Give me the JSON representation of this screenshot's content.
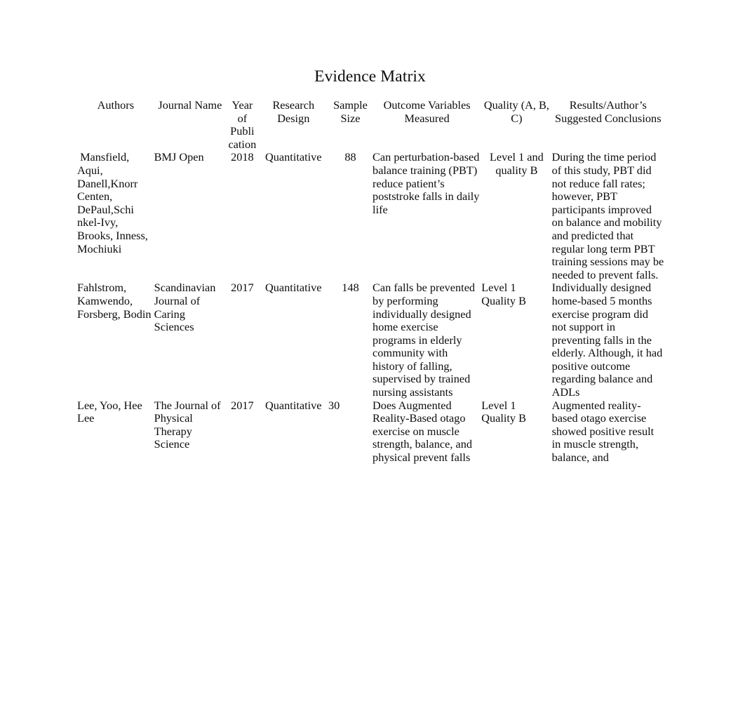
{
  "document": {
    "title": "Evidence Matrix",
    "background_color": "#ffffff",
    "text_color": "#0d0d0d"
  },
  "table": {
    "headers": {
      "authors": "Authors",
      "journal": "Journal Name",
      "year": "Year of Publi cation",
      "design": "Research Design",
      "sample": "Sample Size",
      "outcome": "Outcome Variables Measured",
      "quality": "Quality (A, B, C)",
      "results": "Results/Author’s Suggested Conclusions"
    },
    "rows": [
      {
        "authors": " Mansfield, Aqui, Danell,Knorr Centen, DePaul,Schi nkel-Ivy, Brooks, Inness, Mochiuki",
        "journal": "BMJ Open",
        "year": "2018",
        "design": "Quantitative",
        "sample": "88",
        "outcome": "Can perturbation-based balance training (PBT) reduce patient’s poststroke falls in daily life",
        "quality": "Level 1 and quality B",
        "results": "During the time period of this study, PBT did not reduce fall rates; however, PBT participants improved on balance and mobility and predicted that regular long term PBT training sessions may be needed to prevent falls."
      },
      {
        "authors": "Fahlstrom, Kamwendo, Forsberg, Bodin",
        "journal": "Scandinavian Journal of Caring Sciences",
        "year": "2017",
        "design": "Quantitative",
        "sample": "148",
        "outcome": "Can falls be prevented by performing individually designed home exercise programs in elderly community with history of falling, supervised by trained nursing assistants",
        "quality": "Level 1 Quality B",
        "results": "Individually designed home-based 5 months exercise program did not support in preventing falls in the elderly. Although, it had positive outcome regarding balance and ADLs"
      },
      {
        "authors": "Lee, Yoo, Hee Lee",
        "journal": "The Journal of Physical Therapy Science",
        "year": "2017",
        "design": "Quantitative",
        "sample": "30",
        "outcome": "Does Augmented Reality-Based otago exercise on muscle strength, balance, and physical prevent falls",
        "quality": "Level 1 Quality B",
        "results": "Augmented reality-based otago exercise showed positive result in muscle strength, balance, and"
      }
    ]
  }
}
